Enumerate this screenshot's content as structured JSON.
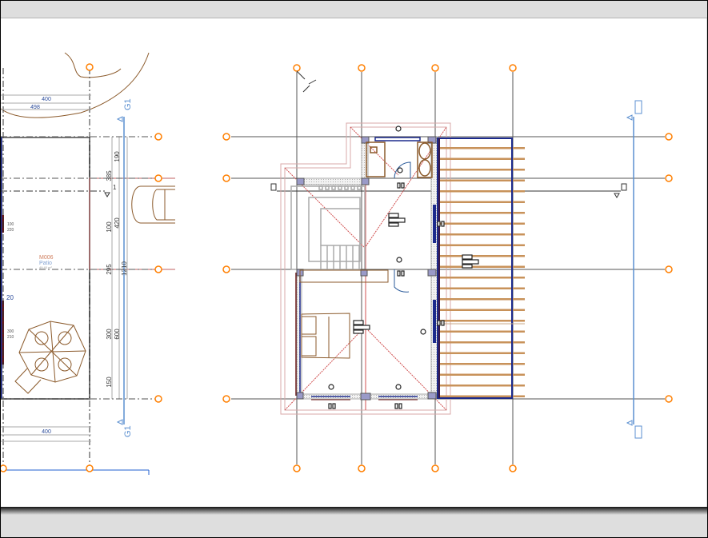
{
  "colors": {
    "grid_bubble": "#ff7f00",
    "section_line": "#5b8fd0",
    "wall_blue": "#1c2a8c",
    "furniture": "#8b5a2b",
    "roof_outline": "#d8a8a8",
    "deck_slat": "#c8925a"
  },
  "grid_axes": {
    "horizontal": [
      "4",
      "3",
      "2",
      "1"
    ]
  },
  "section": {
    "label_top": "G1",
    "label_bottom": "G1"
  },
  "dimensions": {
    "top_1": "400",
    "top_2": "498",
    "bottom_1": "400",
    "v_190": "190",
    "v_385": "385",
    "v_1": "1",
    "v_100": "100",
    "v_420": "420",
    "v_295": "295",
    "v_1210": "1210",
    "v_300": "300",
    "v_600": "600",
    "v_150": "150",
    "opening_1_top": "100",
    "opening_1_bottom": "220",
    "opening_2_label": "20",
    "opening_3_top": "300",
    "opening_3_bottom": "210"
  },
  "room": {
    "code": "M006",
    "name": "Patio",
    "area": "49.40 m²"
  }
}
